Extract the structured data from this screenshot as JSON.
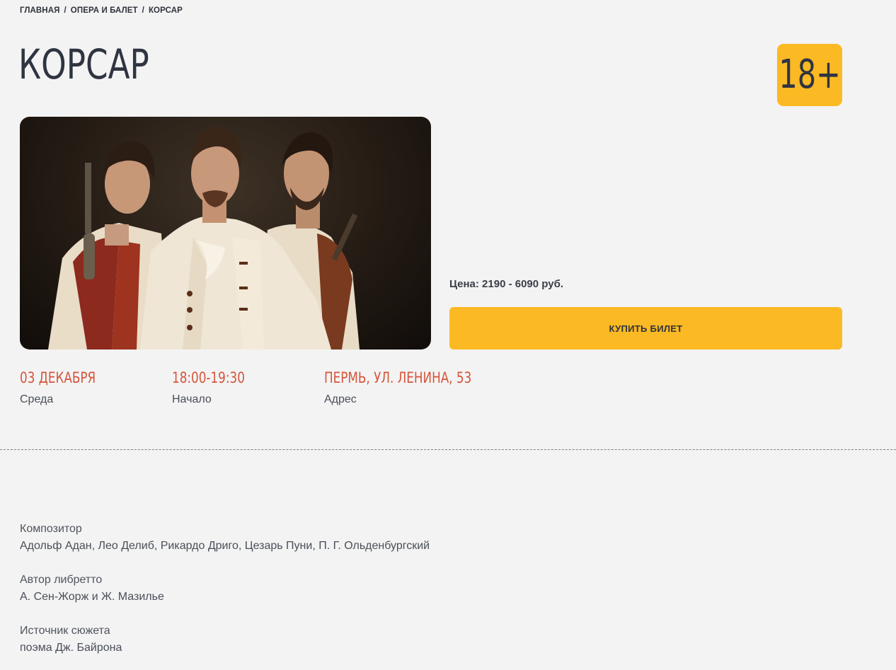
{
  "breadcrumb": {
    "items": [
      "ГЛАВНАЯ",
      "ОПЕРА И БАЛЕТ",
      "КОРСАР"
    ],
    "separator": "/"
  },
  "page": {
    "title": "КОРСАР",
    "age_rating": "18+"
  },
  "purchase": {
    "price": "Цена: 2190 - 6090 руб.",
    "buy_label": "КУПИТЬ БИЛЕТ"
  },
  "event_meta": [
    {
      "value": "03 ДЕКАБРЯ",
      "label": "Среда"
    },
    {
      "value": "18:00-19:30",
      "label": "Начало"
    },
    {
      "value": "ПЕРМЬ, УЛ. ЛЕНИНА, 53",
      "label": "Адрес"
    }
  ],
  "details": [
    {
      "key": "Композитор",
      "value": "Адольф Адан, Лео Делиб, Рикардо Дриго, Цезарь Пуни, П. Г. Ольденбургский"
    },
    {
      "key": "Автор либретто",
      "value": "А. Сен-Жорж и Ж. Мазилье"
    },
    {
      "key": "Источник сюжета",
      "value": "поэма Дж. Байрона"
    }
  ],
  "colors": {
    "accent": "#fbb923",
    "meta_value": "#d4553b",
    "background": "#f3f3f3",
    "text_dark": "#2f3441"
  }
}
